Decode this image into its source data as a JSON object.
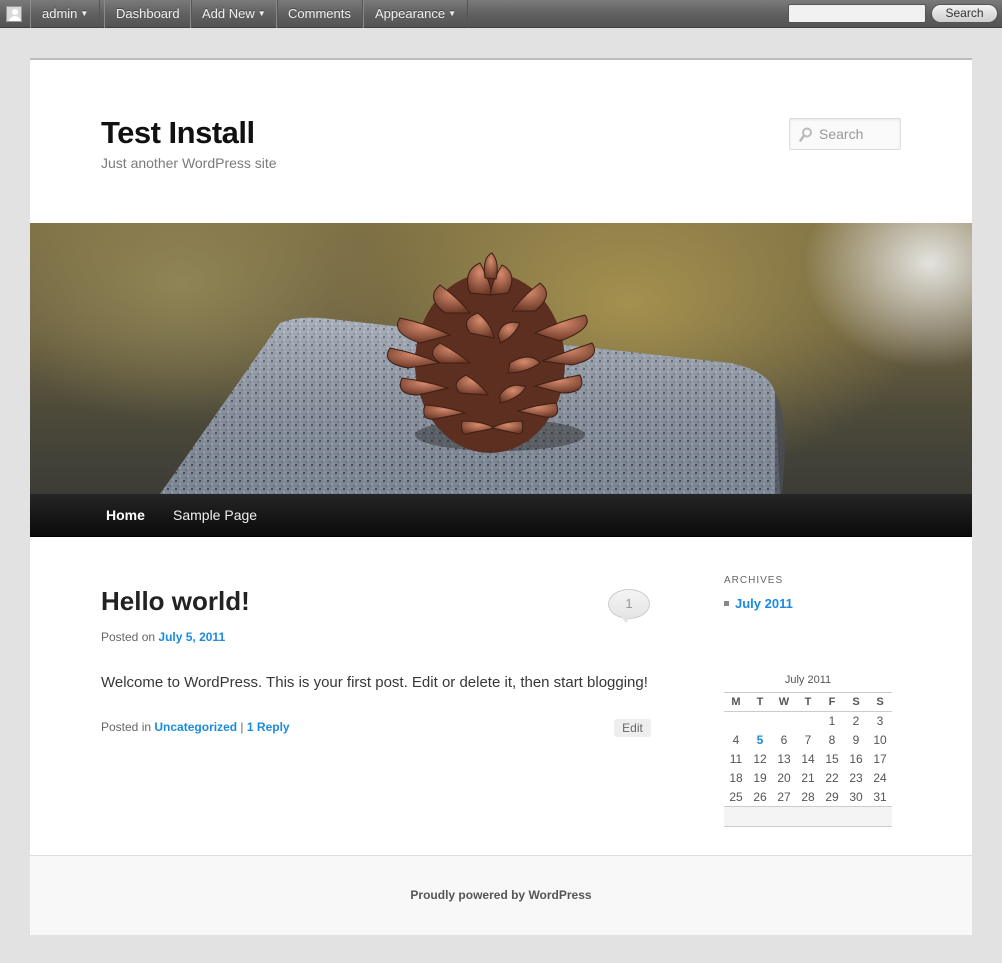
{
  "admin_bar": {
    "user": "admin",
    "items": [
      "Dashboard",
      "Add New",
      "Comments",
      "Appearance"
    ],
    "search_button": "Search"
  },
  "header": {
    "site_title": "Test Install",
    "site_description": "Just another WordPress site",
    "search_placeholder": "Search"
  },
  "nav": {
    "items": [
      "Home",
      "Sample Page"
    ]
  },
  "post": {
    "title": "Hello world!",
    "posted_on_label": "Posted on",
    "date": "July 5, 2011",
    "comment_count": "1",
    "content": "Welcome to WordPress. This is your first post. Edit or delete it, then start blogging!",
    "posted_in_label": "Posted in",
    "category": "Uncategorized",
    "separator": "|",
    "replies": "1 Reply",
    "edit_label": "Edit"
  },
  "sidebar": {
    "archives_title": "Archives",
    "archives": [
      "July 2011"
    ],
    "calendar": {
      "caption": "July 2011",
      "weekdays": [
        "M",
        "T",
        "W",
        "T",
        "F",
        "S",
        "S"
      ],
      "weeks": [
        [
          "",
          "",
          "",
          "",
          "1",
          "2",
          "3"
        ],
        [
          "4",
          "5",
          "6",
          "7",
          "8",
          "9",
          "10"
        ],
        [
          "11",
          "12",
          "13",
          "14",
          "15",
          "16",
          "17"
        ],
        [
          "18",
          "19",
          "20",
          "21",
          "22",
          "23",
          "24"
        ],
        [
          "25",
          "26",
          "27",
          "28",
          "29",
          "30",
          "31"
        ]
      ],
      "linked_day": "5"
    }
  },
  "footer": {
    "credits": "Proudly powered by WordPress"
  },
  "colors": {
    "link": "#1b8be0",
    "nav_bg": "#111111",
    "admin_bar_bg": "#5f5f5f"
  }
}
